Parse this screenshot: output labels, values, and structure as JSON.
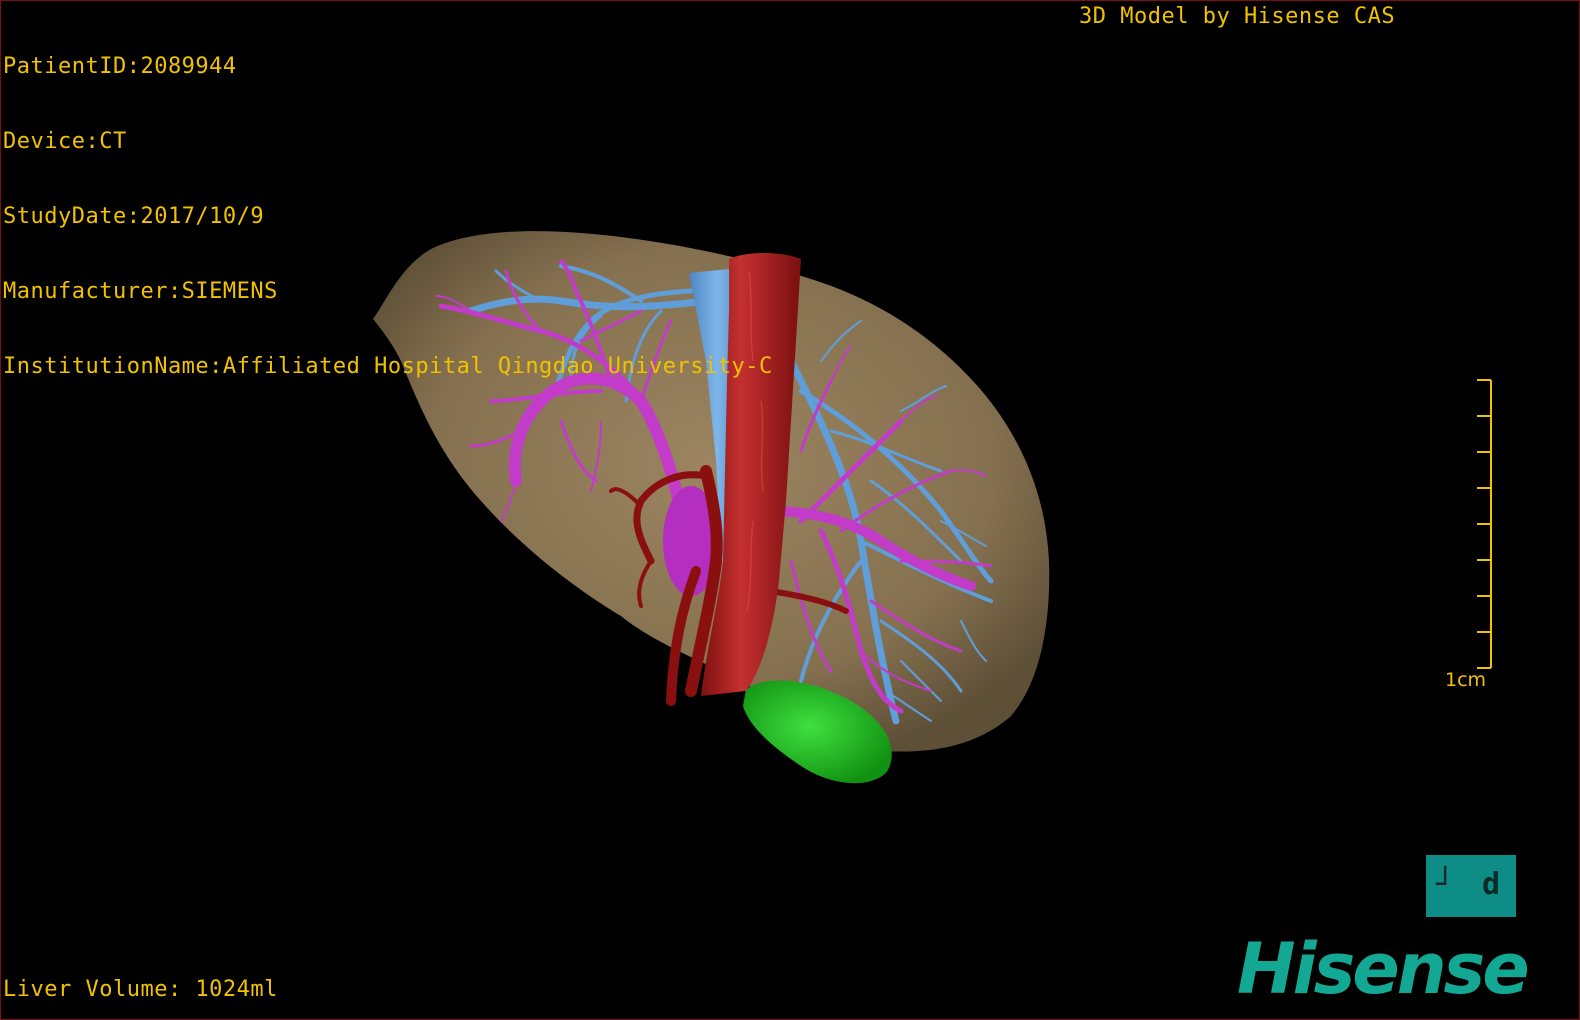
{
  "header": {
    "patient_id": "PatientID:2089944",
    "device": "Device:CT",
    "study_date": "StudyDate:2017/10/9",
    "manufacturer": "Manufacturer:SIEMENS",
    "institution": "InstitutionName:Affiliated Hospital Qingdao University-C",
    "model_credit": "3D Model by Hisense CAS"
  },
  "footer": {
    "liver_volume": "Liver Volume: 1024ml"
  },
  "scale_bar": {
    "label": "1cm"
  },
  "orientation_cube": {
    "glyph_left": "┘",
    "glyph_right": "d"
  },
  "logo": {
    "brand": "Hisense"
  },
  "colors": {
    "text": "#f2c200",
    "liver": "#8b7250",
    "portal_vein": "#c23bc9",
    "hepatic_vein": "#5f9ed8",
    "ivc": "#b22828",
    "hepatic_artery": "#8a0f0f",
    "gallbladder": "#1fbf1f",
    "logo": "#13a894",
    "orientation_cube": "#0e8c86"
  }
}
